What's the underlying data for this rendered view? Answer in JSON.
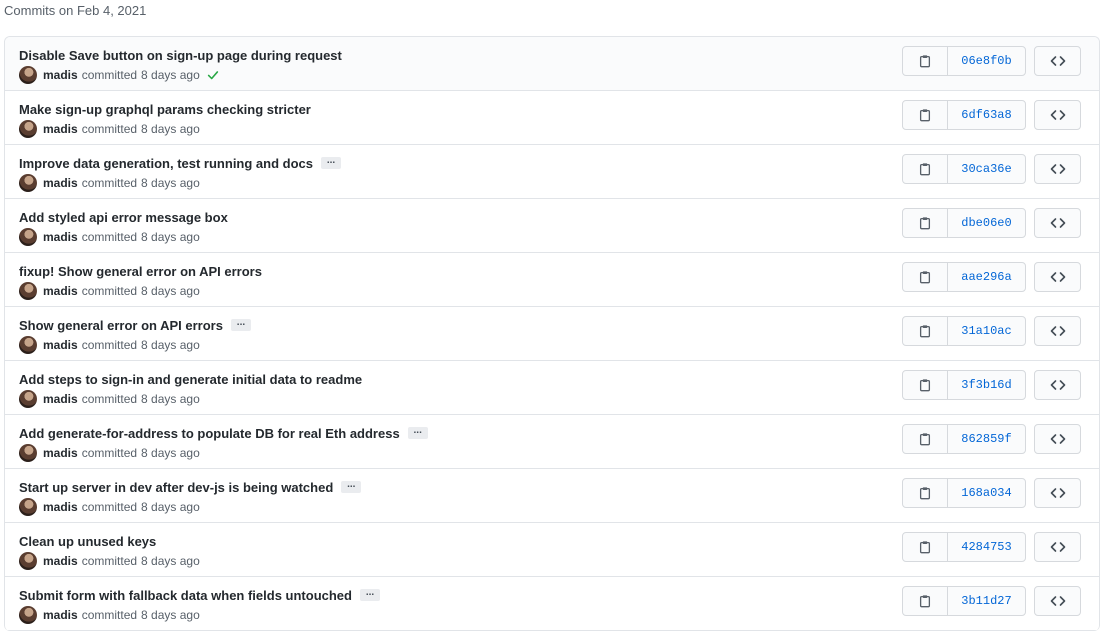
{
  "group_title": "Commits on Feb 4, 2021",
  "colors": {
    "link": "#0366d6",
    "success": "#28a745",
    "border": "#e1e4e8",
    "muted_text": "#586069"
  },
  "ellipsis_label": "...",
  "commits": [
    {
      "title": "Disable Save button on sign-up page during request",
      "author": "madis",
      "verb": "committed",
      "time": "8 days ago",
      "sha": "06e8f0b",
      "has_ellipsis": false,
      "verified_check": true
    },
    {
      "title": "Make sign-up graphql params checking stricter",
      "author": "madis",
      "verb": "committed",
      "time": "8 days ago",
      "sha": "6df63a8",
      "has_ellipsis": false,
      "verified_check": false
    },
    {
      "title": "Improve data generation, test running and docs",
      "author": "madis",
      "verb": "committed",
      "time": "8 days ago",
      "sha": "30ca36e",
      "has_ellipsis": true,
      "verified_check": false
    },
    {
      "title": "Add styled api error message box",
      "author": "madis",
      "verb": "committed",
      "time": "8 days ago",
      "sha": "dbe06e0",
      "has_ellipsis": false,
      "verified_check": false
    },
    {
      "title": "fixup! Show general error on API errors",
      "author": "madis",
      "verb": "committed",
      "time": "8 days ago",
      "sha": "aae296a",
      "has_ellipsis": false,
      "verified_check": false
    },
    {
      "title": "Show general error on API errors",
      "author": "madis",
      "verb": "committed",
      "time": "8 days ago",
      "sha": "31a10ac",
      "has_ellipsis": true,
      "verified_check": false
    },
    {
      "title": "Add steps to sign-in and generate initial data to readme",
      "author": "madis",
      "verb": "committed",
      "time": "8 days ago",
      "sha": "3f3b16d",
      "has_ellipsis": false,
      "verified_check": false
    },
    {
      "title": "Add generate-for-address to populate DB for real Eth address",
      "author": "madis",
      "verb": "committed",
      "time": "8 days ago",
      "sha": "862859f",
      "has_ellipsis": true,
      "verified_check": false
    },
    {
      "title": "Start up server in dev after dev-js is being watched",
      "author": "madis",
      "verb": "committed",
      "time": "8 days ago",
      "sha": "168a034",
      "has_ellipsis": true,
      "verified_check": false
    },
    {
      "title": "Clean up unused keys",
      "author": "madis",
      "verb": "committed",
      "time": "8 days ago",
      "sha": "4284753",
      "has_ellipsis": false,
      "verified_check": false
    },
    {
      "title": "Submit form with fallback data when fields untouched",
      "author": "madis",
      "verb": "committed",
      "time": "8 days ago",
      "sha": "3b11d27",
      "has_ellipsis": true,
      "verified_check": false
    }
  ]
}
